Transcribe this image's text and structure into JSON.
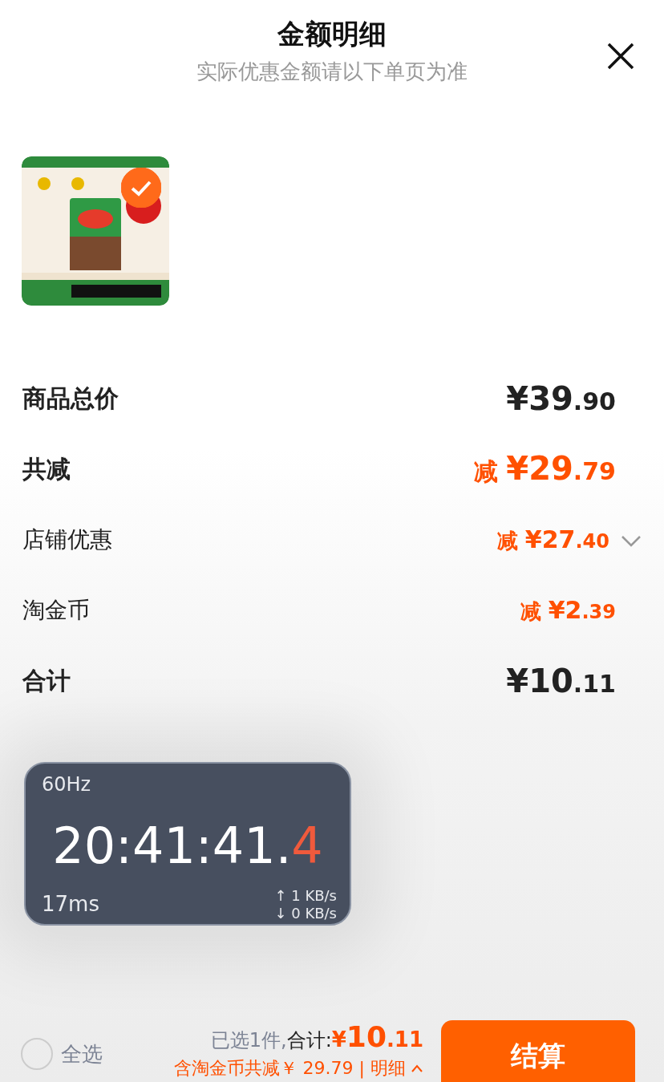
{
  "header": {
    "title": "金额明细",
    "subtitle": "实际优惠金额请以下单页为准"
  },
  "product": {
    "selected": true
  },
  "rows": [
    {
      "label": "商品总价",
      "kind": "major",
      "color": "#222222",
      "main": "¥39",
      "cents": ".90",
      "expandable": false
    },
    {
      "label": "共减",
      "kind": "major",
      "color": "#ff5000",
      "prefix": "减",
      "main": "¥29",
      "cents": ".79",
      "expandable": false
    },
    {
      "label": "店铺优惠",
      "kind": "minor",
      "color": "#ff5000",
      "prefix": "减",
      "main": "¥27",
      "cents": ".40",
      "expandable": true
    },
    {
      "label": "淘金币",
      "kind": "minor",
      "color": "#ff5000",
      "prefix": "减",
      "main": "¥2",
      "cents": ".39",
      "expandable": false
    },
    {
      "label": "合计",
      "kind": "major",
      "color": "#222222",
      "main": "¥10",
      "cents": ".11",
      "expandable": false
    }
  ],
  "overlay": {
    "refresh": "60Hz",
    "time": "20:41:41.",
    "time_fraction": "4",
    "latency": "17ms",
    "upload": "↑ 1 KB/s",
    "download": "↓ 0 KB/s"
  },
  "bottom_bar": {
    "select_all": {
      "label": "全选",
      "checked": false
    },
    "selected_text": "已选1件,",
    "total_label": "合计:",
    "total_yuan": "¥",
    "total_main": "10",
    "total_cents": ".11",
    "savings": "含淘金币共减￥ 29.79 | 明细",
    "checkout": "结算"
  }
}
